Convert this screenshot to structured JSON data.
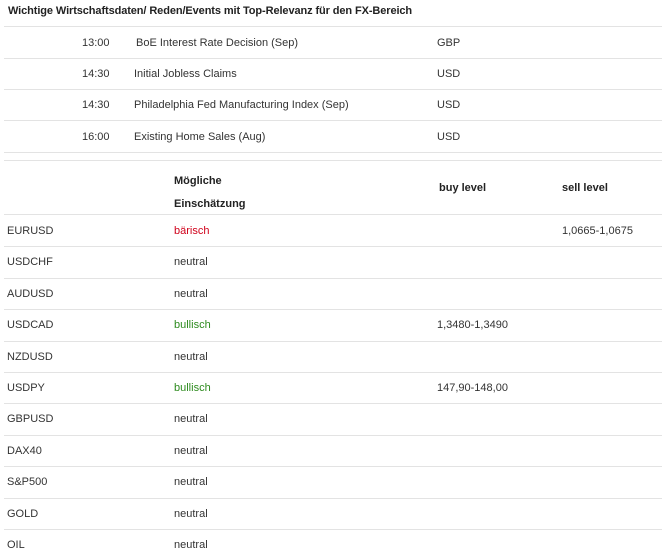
{
  "title": "Wichtige Wirtschaftsdaten/ Reden/Events mit Top-Relevanz für den FX-Bereich",
  "events": [
    {
      "time": "13:00",
      "name": "BoE Interest Rate Decision (Sep)",
      "currency": "GBP"
    },
    {
      "time": "14:30",
      "name": "Initial Jobless Claims",
      "currency": "USD"
    },
    {
      "time": "14:30",
      "name": "Philadelphia Fed Manufacturing Index (Sep)",
      "currency": "USD"
    },
    {
      "time": "16:00",
      "name": "Existing Home Sales (Aug)",
      "currency": "USD"
    }
  ],
  "table_header": {
    "estimate_line1": "Mögliche",
    "estimate_line2": "Einschätzung",
    "buy_level": "buy level",
    "sell_level": "sell level"
  },
  "assets": [
    {
      "symbol": "EURUSD",
      "estimate": "bärisch",
      "sentiment": "bearish",
      "buy": "",
      "sell": "1,0665-1,0675"
    },
    {
      "symbol": "USDCHF",
      "estimate": "neutral",
      "sentiment": "neutral",
      "buy": "",
      "sell": ""
    },
    {
      "symbol": "AUDUSD",
      "estimate": "neutral",
      "sentiment": "neutral",
      "buy": "",
      "sell": ""
    },
    {
      "symbol": "USDCAD",
      "estimate": "bullisch",
      "sentiment": "bullish",
      "buy": "1,3480-1,3490",
      "sell": ""
    },
    {
      "symbol": "NZDUSD",
      "estimate": "neutral",
      "sentiment": "neutral",
      "buy": "",
      "sell": ""
    },
    {
      "symbol": "USDPY",
      "estimate": "bullisch",
      "sentiment": "bullish",
      "buy": "147,90-148,00",
      "sell": ""
    },
    {
      "symbol": "GBPUSD",
      "estimate": "neutral",
      "sentiment": "neutral",
      "buy": "",
      "sell": ""
    },
    {
      "symbol": "DAX40",
      "estimate": "neutral",
      "sentiment": "neutral",
      "buy": "",
      "sell": ""
    },
    {
      "symbol": "S&P500",
      "estimate": "neutral",
      "sentiment": "neutral",
      "buy": "",
      "sell": ""
    },
    {
      "symbol": "GOLD",
      "estimate": "neutral",
      "sentiment": "neutral",
      "buy": "",
      "sell": ""
    },
    {
      "symbol": "OIL",
      "estimate": "neutral",
      "sentiment": "neutral",
      "buy": "",
      "sell": ""
    }
  ],
  "colors": {
    "bearish": "#d0021b",
    "bullish": "#2e8b1f",
    "neutral": "#333333"
  }
}
